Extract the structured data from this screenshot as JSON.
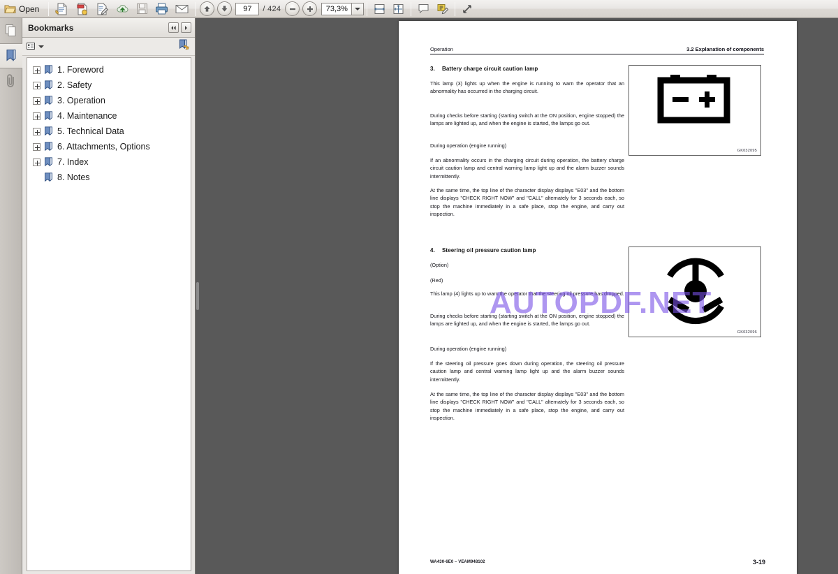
{
  "toolbar": {
    "open_label": "Open",
    "buttons": [
      {
        "name": "open-file-button",
        "label": "Open"
      },
      {
        "name": "create-pdf-button",
        "label": ""
      },
      {
        "name": "combine-files-button",
        "label": ""
      },
      {
        "name": "edit-pdf-button",
        "label": ""
      },
      {
        "name": "upload-cloud-button",
        "label": ""
      },
      {
        "name": "save-button",
        "label": ""
      },
      {
        "name": "print-button",
        "label": ""
      },
      {
        "name": "email-button",
        "label": ""
      }
    ],
    "page_current": "97",
    "page_total": "/ 424",
    "zoom_value": "73,3%",
    "nav": {
      "previous_page": "previous-page-button",
      "next_page": "next-page-button"
    },
    "zoom_out_label": "−",
    "zoom_in_label": "+"
  },
  "sidebar_rail": {
    "items": [
      {
        "name": "page-thumbnails-icon",
        "selected": false
      },
      {
        "name": "bookmarks-icon",
        "selected": true
      },
      {
        "name": "attachments-icon",
        "selected": false
      }
    ]
  },
  "bookmarks_panel": {
    "title": "Bookmarks",
    "collapse_button": "◀◀",
    "expand_button": "▶",
    "options_label": "",
    "items": [
      {
        "label": "1. Foreword",
        "expandable": true
      },
      {
        "label": "2. Safety",
        "expandable": true
      },
      {
        "label": "3. Operation",
        "expandable": true
      },
      {
        "label": "4. Maintenance",
        "expandable": true
      },
      {
        "label": "5. Technical Data",
        "expandable": true
      },
      {
        "label": "6. Attachments, Options",
        "expandable": true
      },
      {
        "label": "7. Index",
        "expandable": true
      },
      {
        "label": "8. Notes",
        "expandable": false
      }
    ]
  },
  "document": {
    "header_left": "Operation",
    "header_right": "3.2  Explanation of components",
    "footer_left": "WA430-6E0 – VEAM948102",
    "footer_right": "3-19",
    "watermark": "AUTOPDF.NET",
    "watermark_color": "#7850e6",
    "sections": [
      {
        "number": "3.",
        "title": "Battery charge circuit caution lamp",
        "figure_caption": "GK032095",
        "figure_icon": "battery-icon",
        "paragraphs": [
          "This lamp (3) lights up when the engine is running to warn the operator that an abnormality has occurred in the charging circuit.",
          "During checks before starting (starting switch at the ON position, engine stopped) the lamps are lighted up, and when the engine is started, the lamps go out.",
          "During operation (engine running)",
          "If an abnormality occurs in the charging circuit during operation, the battery charge circuit caution lamp and central warning lamp light up and the alarm buzzer sounds intermittently.",
          "At the same time, the top line of the character display displays \"E03\" and the bottom line displays \"CHECK RIGHT NOW\" and \"CALL\" alternately for 3 seconds each, so stop the machine immediately in a safe place, stop the engine, and carry out inspection."
        ]
      },
      {
        "number": "4.",
        "title": "Steering oil pressure caution lamp",
        "figure_caption": "GK032096",
        "figure_icon": "steering-wheel-icon",
        "paragraphs": [
          "(Option)",
          "(Red)",
          "This lamp (4) lights up to warn the operator that the steering oil pressure has dropped.",
          "During checks before starting (starting switch at the ON position, engine stopped) the lamps are lighted up, and when the engine is started, the lamps go out.",
          "During operation (engine running)",
          "If the steering oil pressure goes down during operation, the steering oil pressure caution lamp and central warning lamp light up and the alarm buzzer sounds intermittently.",
          "At the same time, the top line of the character display displays \"E03\" and the bottom line displays \"CHECK RIGHT NOW\" and \"CALL\" alternately for 3 seconds each, so stop the machine immediately in a safe place, stop the engine, and carry out inspection."
        ]
      }
    ]
  }
}
